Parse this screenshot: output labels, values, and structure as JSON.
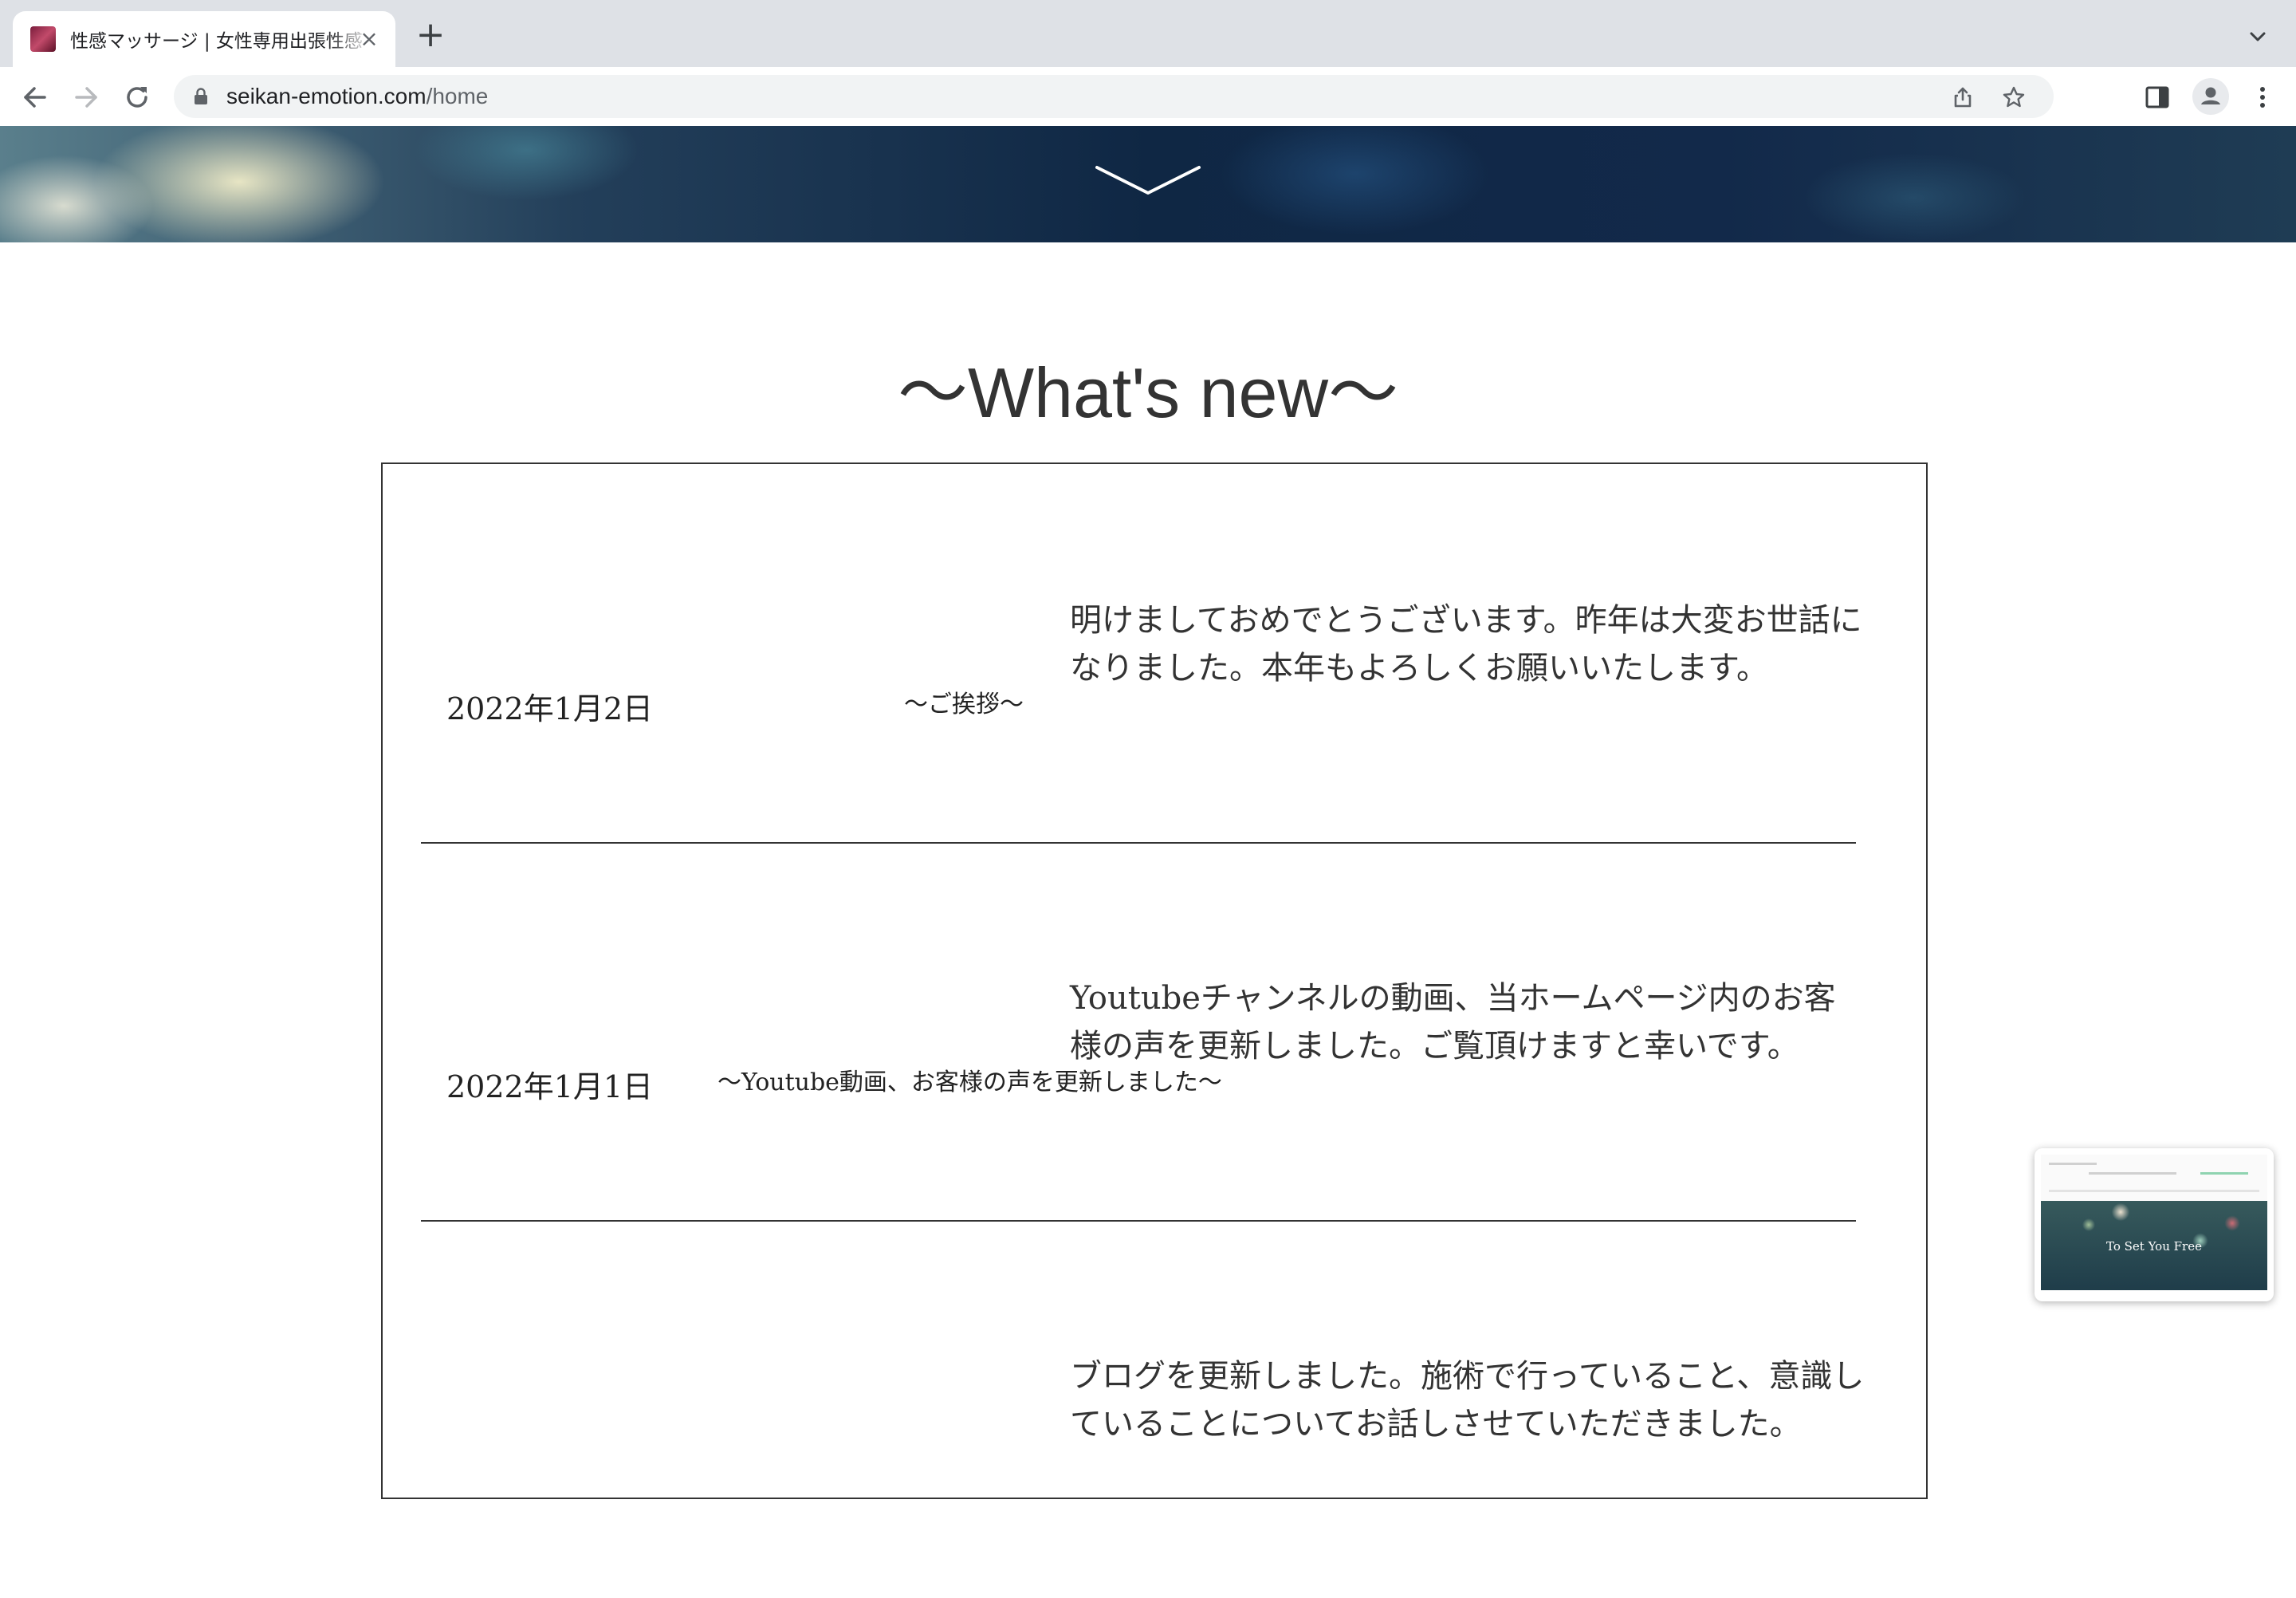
{
  "browser": {
    "tab_title": "性感マッサージ | 女性専用出張性感",
    "tab_close": "×",
    "new_tab": "+",
    "url_host": "seikan-emotion.com",
    "url_path": "/home"
  },
  "page": {
    "section_title": "〜What's new〜",
    "news": [
      {
        "date": "2022年1月2日",
        "heading": "〜ご挨拶〜",
        "body": "明けましておめでとうございます。昨年は大変お世話になりました。本年もよろしくお願いいたします。"
      },
      {
        "date": "2022年1月1日",
        "heading": "〜Youtube動画、お客様の声を更新しました〜",
        "body": "Youtubeチャンネルの動画、当ホームページ内のお客様の声を更新しました。ご覧頂けますと幸いです。"
      },
      {
        "date": "",
        "heading": "",
        "body": "ブログを更新しました。施術で行っていること、意識していることについてお話しさせていただきました。"
      }
    ]
  },
  "preview": {
    "caption": "To Set You Free"
  },
  "icons": {
    "back": "arrow-left-icon",
    "forward": "arrow-right-icon",
    "reload": "reload-icon",
    "lock": "lock-icon",
    "share": "share-icon",
    "bookmark": "star-icon",
    "side_panel": "side-panel-icon",
    "profile": "profile-icon",
    "menu": "more-vert-icon",
    "hero_scroll": "chevron-down-icon"
  }
}
